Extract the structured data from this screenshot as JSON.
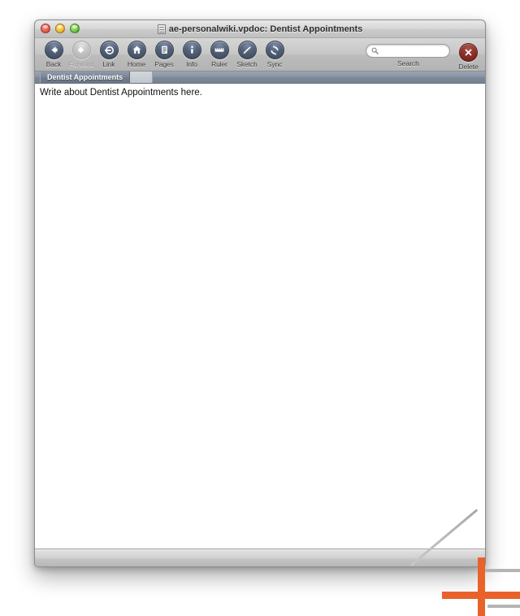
{
  "window": {
    "title": "ae-personalwiki.vpdoc: Dentist Appointments",
    "title_icon": "document-icon",
    "controls": {
      "close_label": "close",
      "minimize_label": "minimize",
      "zoom_label": "zoom"
    }
  },
  "toolbar": {
    "items": [
      {
        "label": "Back",
        "icon": "back-arrow-icon",
        "enabled": true
      },
      {
        "label": "Forward",
        "icon": "forward-arrow-icon",
        "enabled": false
      },
      {
        "label": "Link",
        "icon": "link-icon",
        "enabled": true
      },
      {
        "label": "Home",
        "icon": "home-icon",
        "enabled": true
      },
      {
        "label": "Pages",
        "icon": "pages-icon",
        "enabled": true
      },
      {
        "label": "Info",
        "icon": "info-icon",
        "enabled": true
      },
      {
        "label": "Ruler",
        "icon": "ruler-icon",
        "enabled": true
      },
      {
        "label": "Sketch",
        "icon": "sketch-brush-icon",
        "enabled": true
      },
      {
        "label": "Sync",
        "icon": "sync-icon",
        "enabled": true
      }
    ],
    "search": {
      "label": "Search",
      "placeholder": "",
      "value": "",
      "icon": "search-icon"
    },
    "delete": {
      "label": "Delete",
      "icon": "delete-x-icon"
    }
  },
  "tabs": {
    "items": [
      {
        "label": "Dentist Appointments",
        "selected": true
      }
    ]
  },
  "content": {
    "body_text": "Write about Dentist Appointments here."
  },
  "colors": {
    "tab_bar": "#7d8999",
    "toolbar_orb": "#526179",
    "delete_red": "#8c2f28",
    "crop_mark_orange": "#e8622a",
    "window_chrome": "#c6c6c6"
  }
}
